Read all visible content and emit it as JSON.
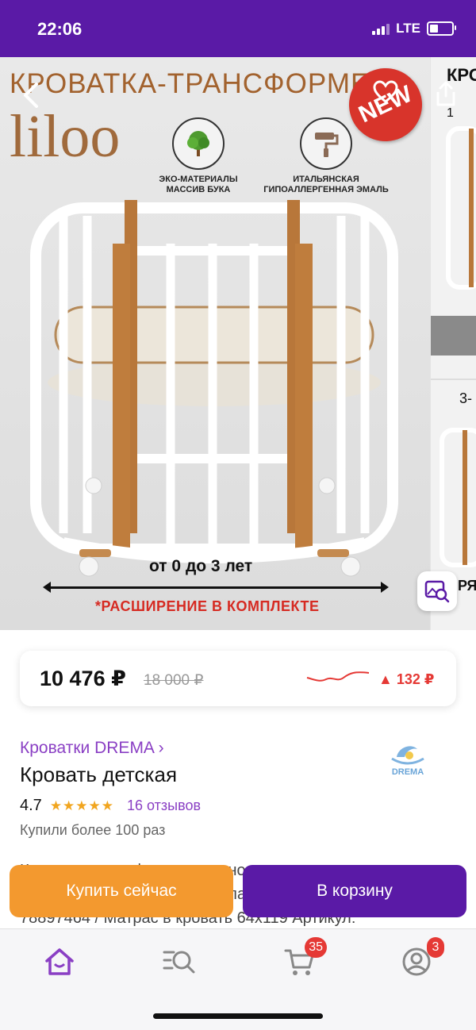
{
  "status_bar": {
    "time": "22:06",
    "network": "LTE"
  },
  "gallery": {
    "headline": "КРОВАТКА-ТРАНСФОРМЕР",
    "logo": "liloo",
    "features": [
      {
        "icon": "tree-icon",
        "line1": "ЭКО-МАТЕРИАЛЫ",
        "line2": "МАССИВ БУКА"
      },
      {
        "icon": "paint-roller-icon",
        "line1": "ИТАЛЬЯНСКАЯ",
        "line2": "ГИПОАЛЛЕРГЕННАЯ ЭМАЛЬ"
      }
    ],
    "sticker": "NEW",
    "age_label": "от 0 до 3 лет",
    "expansion_label": "*РАСШИРЕНИЕ В КОМПЛЕКТЕ",
    "side_top": "КРО",
    "side_one": "1",
    "side_three": "3-",
    "side_tag": "РЯ"
  },
  "price": {
    "current": "10 476 ₽",
    "old": "18 000 ₽",
    "change": "▲ 132 ₽",
    "trend_color": "#e53935"
  },
  "product": {
    "brand_link": "Кроватки DREMA ›",
    "title": "Кровать детская",
    "rating": "4.7",
    "stars": "★★★★★",
    "reviews": "16 отзывов",
    "bought": "Купили более 100 раз",
    "desc_line1": "Кроватка трансформер для новорожденных со",
    "desc_line2": "скидкой 8 в 1 Liloo (Лилу) белая с буком по",
    "desc_line3": "78897464 / Матрас в кровать 64х119 Артикул:",
    "seller_logo_text": "DREMA"
  },
  "actions": {
    "buy_now": "Купить сейчас",
    "add_to_cart": "В корзину"
  },
  "nav": {
    "cart_count": "35",
    "profile_count": "3"
  },
  "colors": {
    "brand_purple": "#5a1aa6",
    "accent_orange": "#f3992f",
    "link_purple": "#8a3fc4",
    "alert_red": "#e53935"
  }
}
